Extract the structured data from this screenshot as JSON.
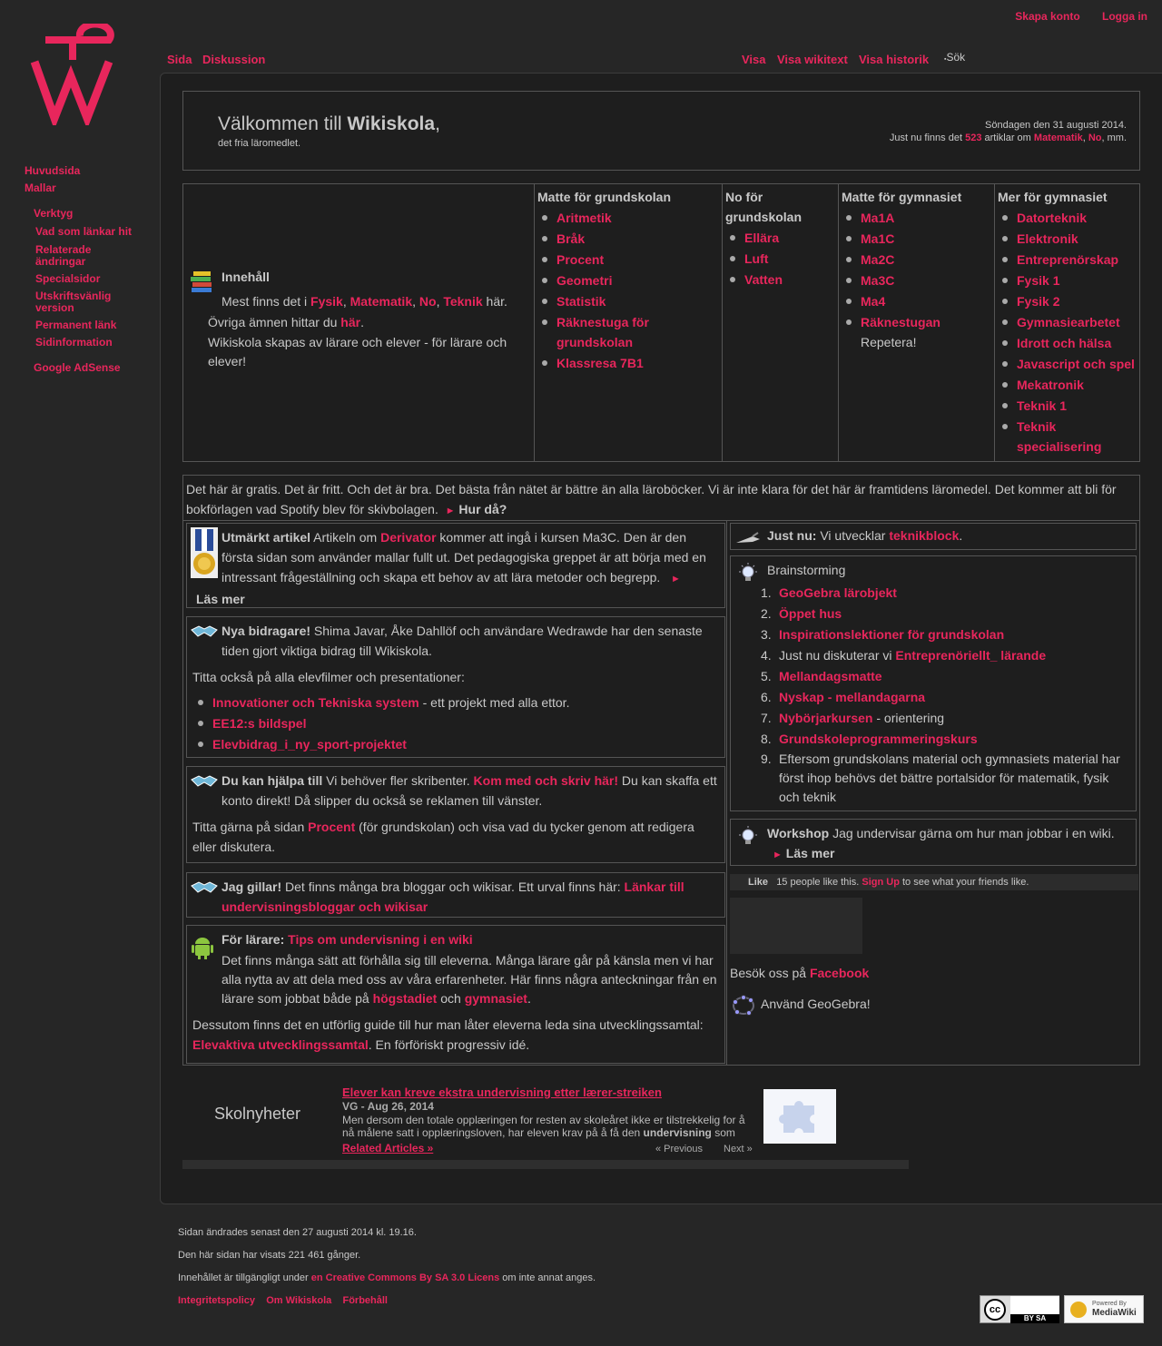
{
  "personal": {
    "create_account": "Skapa konto",
    "login": "Logga in"
  },
  "tabs": {
    "page": "Sida",
    "discussion": "Diskussion",
    "view": "Visa",
    "view_source": "Visa wikitext",
    "history": "Visa historik",
    "search": "Sök"
  },
  "sidebar": {
    "nav": [
      "Huvudsida",
      "Mallar"
    ],
    "tools_title": "Verktyg",
    "tools": [
      "Vad som länkar hit",
      "Relaterade ändringar",
      "Specialsidor",
      "Utskriftsvänlig version",
      "Permanent länk",
      "Sidinformation"
    ],
    "adsense": "Google AdSense"
  },
  "welcome": {
    "prefix": "Välkommen till ",
    "site": "Wikiskola",
    "comma": ",",
    "subtitle": "det fria läromedlet.",
    "date": "Söndagen den 31 augusti 2014.",
    "count_prefix": "Just nu finns det ",
    "count": "523",
    "count_mid": " artiklar om ",
    "subj1": "Matematik",
    "sep": ", ",
    "subj2": "No",
    "suffix": ", mm."
  },
  "contents": {
    "title": "Innehåll",
    "line1_prefix": "Mest finns det i ",
    "s1": "Fysik",
    "s2": "Matematik",
    "s3": "No",
    "s4": "Teknik",
    "line1_suffix": " här.",
    "line2_prefix": "Övriga ämnen hittar du ",
    "line2_link": "här",
    "line2_suffix": ".",
    "line3": "Wikiskola skapas av lärare och elever - för lärare och elever!"
  },
  "columns": [
    {
      "title": "Matte för grundskolan",
      "items": [
        "Aritmetik",
        "Bråk",
        "Procent",
        "Geometri",
        "Statistik",
        "Räknestuga för grundskolan",
        "Klassresa 7B1"
      ]
    },
    {
      "title": "No för grundskolan",
      "items": [
        "Ellära",
        "Luft",
        "Vatten"
      ]
    },
    {
      "title": "Matte för gymnasiet",
      "items": [
        "Ma1A",
        "Ma1C",
        "Ma2C",
        "Ma3C",
        "Ma4",
        "Räknestugan"
      ],
      "note": "Repetera!"
    },
    {
      "title": "Mer för gymnasiet",
      "items": [
        "Datorteknik",
        "Elektronik",
        "Entreprenörskap",
        "Fysik 1",
        "Fysik 2",
        "Gymnasiearbetet",
        "Idrott och hälsa",
        "Javascript och spel",
        "Mekatronik",
        "Teknik 1",
        "Teknik specialisering"
      ]
    }
  ],
  "banner": {
    "text": "Det här är gratis. Det är fritt. Och det är bra. Det bästa från nätet är bättre än alla läroböcker. Vi är inte klara för det här är framtidens läromedel. Det kommer att bli för bokförlagen vad Spotify blev för skivbolagen.",
    "arrow": "►",
    "link": "Hur då?"
  },
  "featured": {
    "title": "Utmärkt artikel",
    "pre": " Artikeln om ",
    "link": "Derivator",
    "text": " kommer att ingå i kursen Ma3C. Den är den första sidan som använder mallar fullt ut. Det pedagogiska greppet är att börja med en intressant frågeställning och skapa ett behov av att lära metoder och begrepp.",
    "arrow": "►",
    "more": "Läs mer"
  },
  "newcontrib": {
    "title": "Nya bidragare!",
    "text": " Shima Javar, Åke Dahllöf och användare Wedrawde har den senaste tiden gjort viktiga bidrag till Wikiskola.",
    "see": "Titta också på alla elevfilmer och presentationer:",
    "l1": "Innovationer och Tekniska system",
    "l1s": " - ett projekt med alla ettor.",
    "l2": "EE12:s bildspel",
    "l3": "Elevbidrag_i_ny_sport-projektet"
  },
  "help": {
    "title": "Du kan hjälpa till",
    "pre": " Vi behöver fler skribenter. ",
    "link": "Kom med och skriv här!",
    "text": " Du kan skaffa ett konto direkt! Då slipper du också se reklamen till vänster.",
    "p2a": "Titta gärna på sidan ",
    "p2link": "Procent",
    "p2b": " (för grundskolan) och visa vad du tycker genom att redigera eller diskutera."
  },
  "likes": {
    "title": "Jag gillar!",
    "text": " Det finns många bra bloggar och wikisar. Ett urval finns här: ",
    "link": "Länkar till undervisningsbloggar och wikisar"
  },
  "teachers": {
    "title": "För lärare:",
    "link": "Tips om undervisning i en wiki",
    "p1a": "Det finns många sätt att förhålla sig till eleverna. Många lärare går på känsla men vi har alla nytta av att dela med oss av våra erfarenheter. Här finns några anteckningar från en lärare som jobbat både på ",
    "p1l1": "högstadiet",
    "p1b": " och ",
    "p1l2": "gymnasiet",
    "p1c": ".",
    "p2": "Dessutom finns det en utförlig guide till hur man låter eleverna leda sina utvecklingssamtal: ",
    "p2link": "Elevaktiva utvecklingssamtal",
    "p2b": ". En förföriskt progressiv idé."
  },
  "justnow": {
    "title": "Just nu:",
    "text": " Vi utvecklar ",
    "link": "teknikblock",
    "end": "."
  },
  "brainstorm": {
    "title": "Brainstorming",
    "items": [
      {
        "n": "1.",
        "link": "GeoGebra lärobjekt"
      },
      {
        "n": "2.",
        "link": "Öppet hus"
      },
      {
        "n": "3.",
        "link": "Inspirationslektioner för grundskolan"
      },
      {
        "n": "4.",
        "pre": "Just nu diskuterar vi ",
        "link": "Entreprenöriellt_ lärande"
      },
      {
        "n": "5.",
        "link": "Mellandagsmatte"
      },
      {
        "n": "6.",
        "link": "Nyskap - mellandagarna"
      },
      {
        "n": "7.",
        "link": "Nybörjarkursen",
        "post": " - orientering"
      },
      {
        "n": "8.",
        "link": "Grundskoleprogrammeringskurs"
      },
      {
        "n": "9.",
        "pre": "Eftersom grundskolans material och gymnasiets material har först ihop behövs det bättre portalsidor för matematik, fysik och teknik"
      }
    ]
  },
  "workshop": {
    "title": "Workshop",
    "text": " Jag undervisar gärna om hur man jobbar i en wiki.",
    "arrow": "►",
    "more": "Läs mer"
  },
  "facebook": {
    "like": "Like",
    "count_text": "15 people like this.",
    "signup": "Sign Up",
    "rest": " to see what your friends like.",
    "visit": "Besök oss på ",
    "link": "Facebook"
  },
  "geogebra": {
    "text": "Använd GeoGebra!"
  },
  "news": {
    "label": "Skolnyheter",
    "headline": "Elever kan kreve ekstra undervisning etter lærer-streiken",
    "source": "VG",
    "date": " - Aug 26, 2014",
    "snippet_a": "Men dersom den totale opplæringen for resten av skoleåret ikke er tilstrekkelig for å nå målene satt i opplæringsloven, har eleven krav på å få den ",
    "snippet_b": "undervisning",
    "snippet_c": " som",
    "related": "Related Articles »",
    "prev": "« Previous",
    "next": "Next »"
  },
  "footer": {
    "modified": "Sidan ändrades senast den 27 augusti 2014 kl. 19.16.",
    "views": "Den här sidan har visats 221 461 gånger.",
    "license_pre": "Innehållet är tillgängligt under ",
    "license_link": "en Creative Commons By SA 3.0 Licens",
    "license_post": " om inte annat anges.",
    "links": [
      "Integritetspolicy",
      "Om Wikiskola",
      "Förbehåll"
    ],
    "cc": "BY SA",
    "mw1": "Powered By",
    "mw2": "MediaWiki"
  },
  "colors": {
    "accent": "#e8265c",
    "background": "#262626",
    "panel": "#1e1e1e"
  }
}
